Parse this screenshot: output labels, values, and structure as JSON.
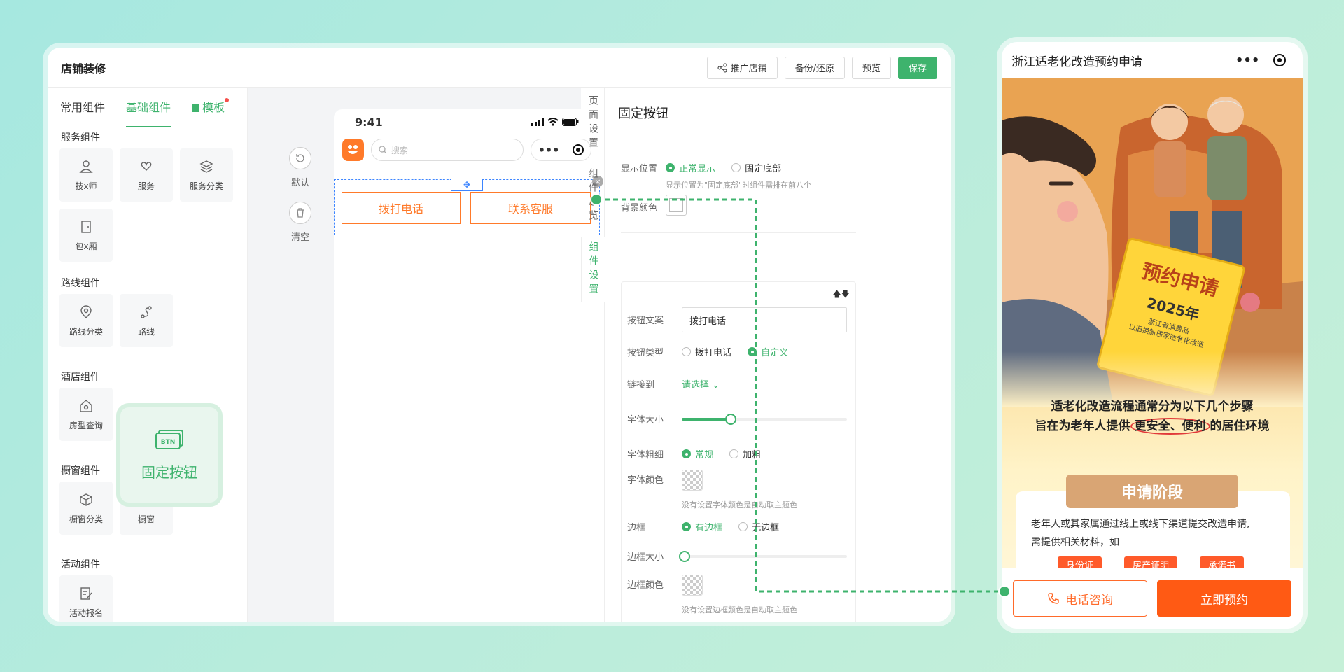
{
  "editor": {
    "title": "店铺装修",
    "buttons": {
      "promote": "推广店铺",
      "backup": "备份/还原",
      "preview": "预览",
      "save": "保存"
    }
  },
  "left_panel": {
    "tabs": [
      "常用组件",
      "基础组件",
      "模板"
    ],
    "groups": {
      "service": {
        "title": "服务组件",
        "items": [
          "技x师",
          "服务",
          "服务分类",
          "包x厢"
        ]
      },
      "route": {
        "title": "路线组件",
        "items": [
          "路线分类",
          "路线"
        ]
      },
      "hotel": {
        "title": "酒店组件",
        "items": [
          "房型查询"
        ]
      },
      "window": {
        "title": "橱窗组件",
        "items": [
          "橱窗分类",
          "橱窗"
        ]
      },
      "activity": {
        "title": "活动组件",
        "items": [
          "活动报名"
        ]
      }
    },
    "drag_card": {
      "icon_text": "BTN",
      "label": "固定按钮"
    }
  },
  "canvas": {
    "actions": {
      "reset": "默认",
      "clear": "清空"
    },
    "phone": {
      "time": "9:41",
      "search_placeholder": "搜索",
      "buttons": [
        "拨打电话",
        "联系客服"
      ]
    }
  },
  "vertical_tabs": [
    "页面设置",
    "组件总览",
    "组件设置"
  ],
  "settings": {
    "title": "固定按钮",
    "display_position": {
      "label": "显示位置",
      "options": [
        "正常显示",
        "固定底部"
      ],
      "selected": "正常显示",
      "hint": "显示位置为\"固定底部\"时组件需排在前八个"
    },
    "bg_color_label": "背景颜色",
    "button_text": {
      "label": "按钮文案",
      "value": "拨打电话"
    },
    "button_type": {
      "label": "按钮类型",
      "options": [
        "拨打电话",
        "自定义"
      ],
      "selected": "自定义"
    },
    "link": {
      "label": "链接到",
      "value": "请选择"
    },
    "font_size": {
      "label": "字体大小",
      "level": 0.3
    },
    "font_weight": {
      "label": "字体粗细",
      "options": [
        "常规",
        "加粗"
      ],
      "selected": "常规"
    },
    "font_color": {
      "label": "字体颜色",
      "hint": "没有设置字体颜色是自动取主题色"
    },
    "border": {
      "label": "边框",
      "options": [
        "有边框",
        "无边框"
      ],
      "selected": "有边框"
    },
    "border_size": {
      "label": "边框大小",
      "level": 0
    },
    "border_color": {
      "label": "边框颜色",
      "hint": "没有设置边框颜色是自动取主题色"
    }
  },
  "preview": {
    "title": "浙江适老化改造预约申请",
    "poster": {
      "book_title": "预约申请",
      "book_year": "2025年",
      "book_sub1": "浙江省消费品",
      "book_sub2": "以旧换新居家适老化改造",
      "line1": "适老化改造流程通常分为以下几个步骤",
      "line2_a": "旨在为老年人提供",
      "line2_b": "更安全、便利",
      "line2_c": "的居住环境",
      "stage_title": "申请阶段",
      "stage_text1": "老年人或其家属通过线上或线下渠道提交改造申请,",
      "stage_text2": "需提供相关材料，如",
      "tags": [
        "身份证",
        "房产证明",
        "承诺书"
      ]
    },
    "buttons": {
      "call": "电话咨询",
      "book": "立即预约"
    }
  },
  "colors": {
    "accent": "#3eb36d",
    "orange": "#ff7a2a",
    "preview_orange": "#ff5a14"
  }
}
